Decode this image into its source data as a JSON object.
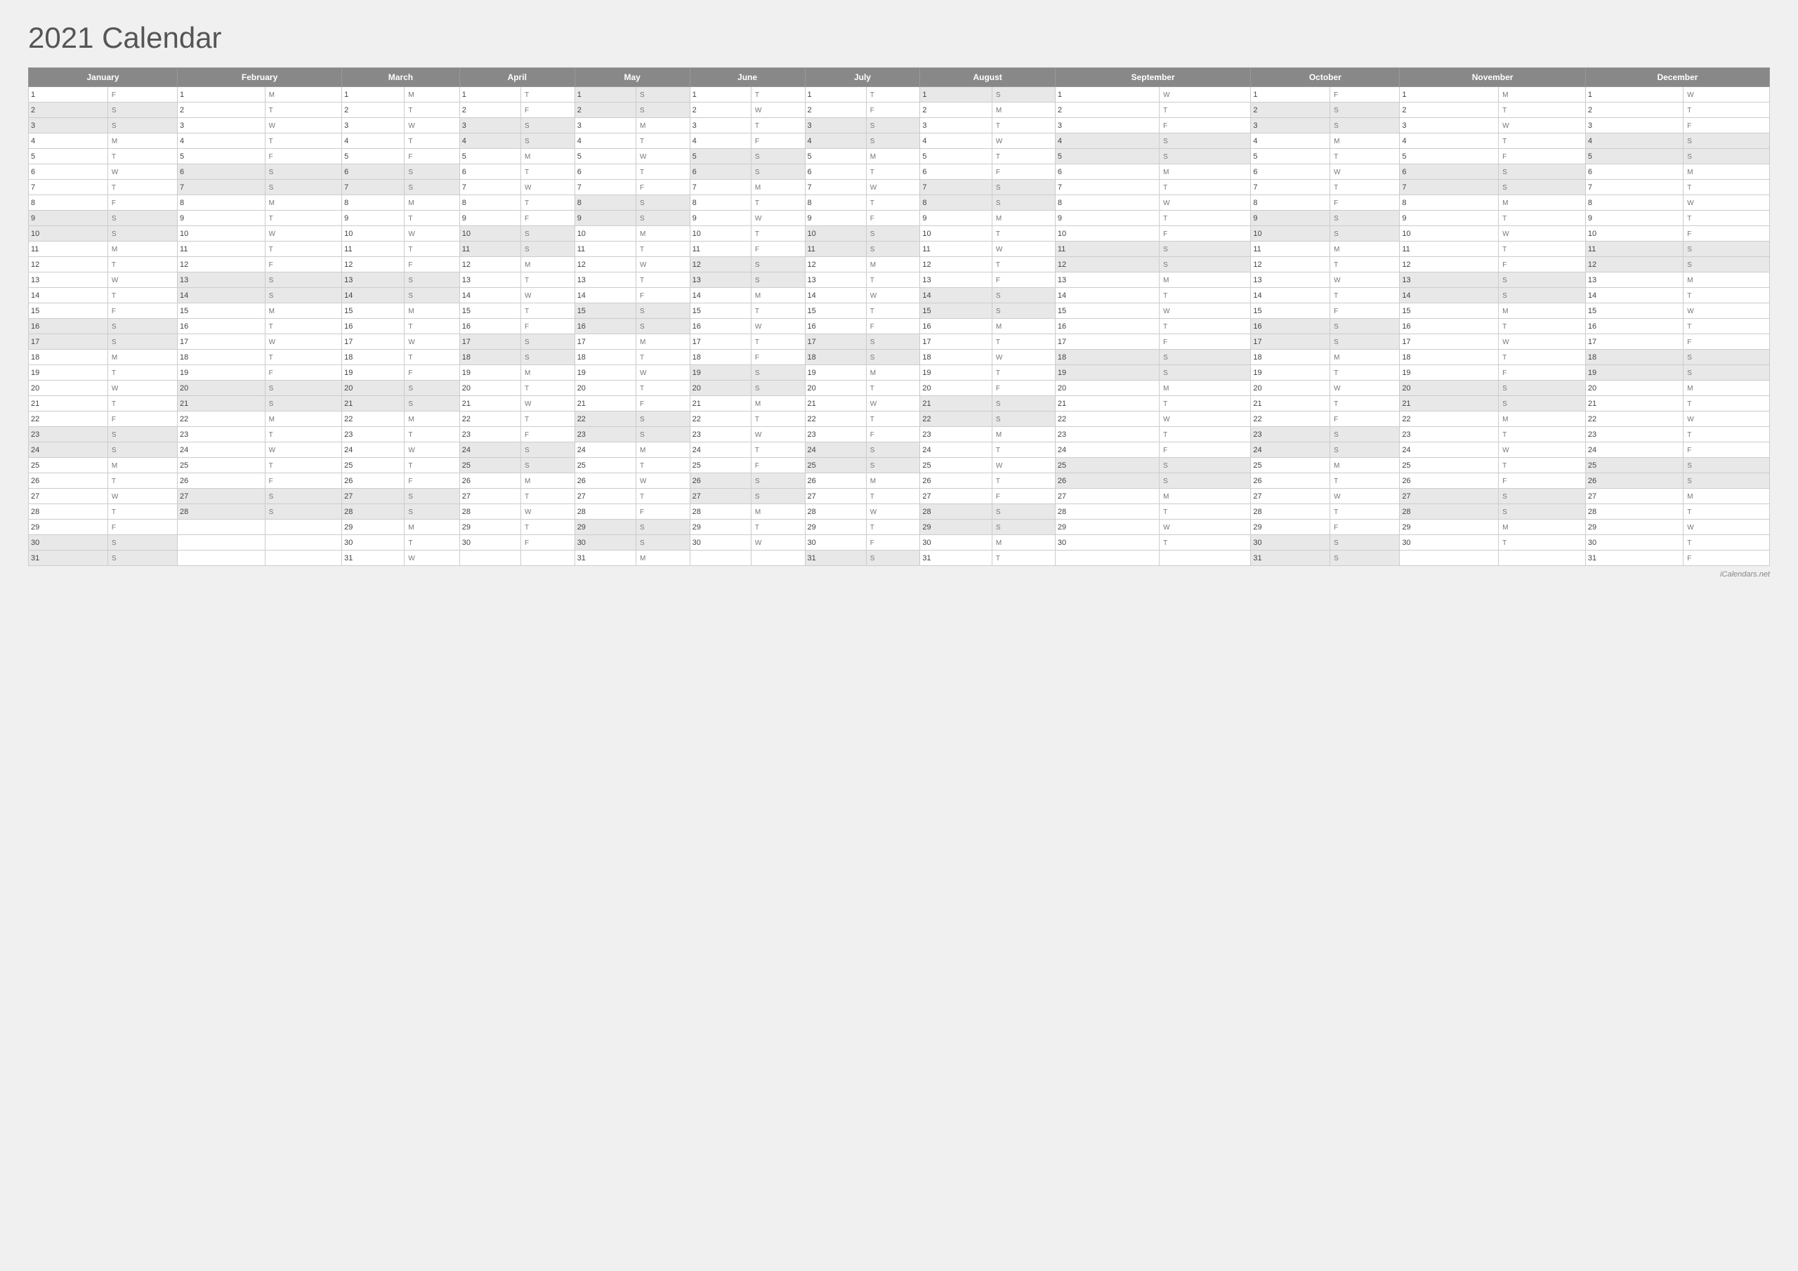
{
  "title": "2021 Calendar",
  "footer": "iCalendars.net",
  "months": [
    "January",
    "February",
    "March",
    "April",
    "May",
    "June",
    "July",
    "August",
    "September",
    "October",
    "November",
    "December"
  ],
  "calendar": {
    "January": [
      [
        "1",
        "F"
      ],
      [
        "2",
        "S"
      ],
      [
        "3",
        "S"
      ],
      [
        "4",
        "M"
      ],
      [
        "5",
        "T"
      ],
      [
        "6",
        "W"
      ],
      [
        "7",
        "T"
      ],
      [
        "8",
        "F"
      ],
      [
        "9",
        "S"
      ],
      [
        "10",
        "S"
      ],
      [
        "11",
        "M"
      ],
      [
        "12",
        "T"
      ],
      [
        "13",
        "W"
      ],
      [
        "14",
        "T"
      ],
      [
        "15",
        "F"
      ],
      [
        "16",
        "S"
      ],
      [
        "17",
        "S"
      ],
      [
        "18",
        "M"
      ],
      [
        "19",
        "T"
      ],
      [
        "20",
        "W"
      ],
      [
        "21",
        "T"
      ],
      [
        "22",
        "F"
      ],
      [
        "23",
        "S"
      ],
      [
        "24",
        "S"
      ],
      [
        "25",
        "M"
      ],
      [
        "26",
        "T"
      ],
      [
        "27",
        "W"
      ],
      [
        "28",
        "T"
      ],
      [
        "29",
        "F"
      ],
      [
        "30",
        "S"
      ],
      [
        "31",
        "S"
      ]
    ],
    "February": [
      [
        "1",
        "M"
      ],
      [
        "2",
        "T"
      ],
      [
        "3",
        "W"
      ],
      [
        "4",
        "T"
      ],
      [
        "5",
        "F"
      ],
      [
        "6",
        "S"
      ],
      [
        "7",
        "S"
      ],
      [
        "8",
        "M"
      ],
      [
        "9",
        "T"
      ],
      [
        "10",
        "W"
      ],
      [
        "11",
        "T"
      ],
      [
        "12",
        "F"
      ],
      [
        "13",
        "S"
      ],
      [
        "14",
        "S"
      ],
      [
        "15",
        "M"
      ],
      [
        "16",
        "T"
      ],
      [
        "17",
        "W"
      ],
      [
        "18",
        "T"
      ],
      [
        "19",
        "F"
      ],
      [
        "20",
        "S"
      ],
      [
        "21",
        "S"
      ],
      [
        "22",
        "M"
      ],
      [
        "23",
        "T"
      ],
      [
        "24",
        "W"
      ],
      [
        "25",
        "T"
      ],
      [
        "26",
        "F"
      ],
      [
        "27",
        "S"
      ],
      [
        "28",
        "S"
      ],
      null,
      null,
      null
    ],
    "March": [
      [
        "1",
        "M"
      ],
      [
        "2",
        "T"
      ],
      [
        "3",
        "W"
      ],
      [
        "4",
        "T"
      ],
      [
        "5",
        "F"
      ],
      [
        "6",
        "S"
      ],
      [
        "7",
        "S"
      ],
      [
        "8",
        "M"
      ],
      [
        "9",
        "T"
      ],
      [
        "10",
        "W"
      ],
      [
        "11",
        "T"
      ],
      [
        "12",
        "F"
      ],
      [
        "13",
        "S"
      ],
      [
        "14",
        "S"
      ],
      [
        "15",
        "M"
      ],
      [
        "16",
        "T"
      ],
      [
        "17",
        "W"
      ],
      [
        "18",
        "T"
      ],
      [
        "19",
        "F"
      ],
      [
        "20",
        "S"
      ],
      [
        "21",
        "S"
      ],
      [
        "22",
        "M"
      ],
      [
        "23",
        "T"
      ],
      [
        "24",
        "W"
      ],
      [
        "25",
        "T"
      ],
      [
        "26",
        "F"
      ],
      [
        "27",
        "S"
      ],
      [
        "28",
        "S"
      ],
      [
        "29",
        "M"
      ],
      [
        "30",
        "T"
      ],
      [
        "31",
        "W"
      ]
    ],
    "April": [
      [
        "1",
        "T"
      ],
      [
        "2",
        "F"
      ],
      [
        "3",
        "S"
      ],
      [
        "4",
        "S"
      ],
      [
        "5",
        "M"
      ],
      [
        "6",
        "T"
      ],
      [
        "7",
        "W"
      ],
      [
        "8",
        "T"
      ],
      [
        "9",
        "F"
      ],
      [
        "10",
        "S"
      ],
      [
        "11",
        "S"
      ],
      [
        "12",
        "M"
      ],
      [
        "13",
        "T"
      ],
      [
        "14",
        "W"
      ],
      [
        "15",
        "T"
      ],
      [
        "16",
        "F"
      ],
      [
        "17",
        "S"
      ],
      [
        "18",
        "S"
      ],
      [
        "19",
        "M"
      ],
      [
        "20",
        "T"
      ],
      [
        "21",
        "W"
      ],
      [
        "22",
        "T"
      ],
      [
        "23",
        "F"
      ],
      [
        "24",
        "S"
      ],
      [
        "25",
        "S"
      ],
      [
        "26",
        "M"
      ],
      [
        "27",
        "T"
      ],
      [
        "28",
        "W"
      ],
      [
        "29",
        "T"
      ],
      [
        "30",
        "F"
      ],
      null
    ],
    "May": [
      [
        "1",
        "S"
      ],
      [
        "2",
        "S"
      ],
      [
        "3",
        "M"
      ],
      [
        "4",
        "T"
      ],
      [
        "5",
        "W"
      ],
      [
        "6",
        "T"
      ],
      [
        "7",
        "F"
      ],
      [
        "8",
        "S"
      ],
      [
        "9",
        "S"
      ],
      [
        "10",
        "M"
      ],
      [
        "11",
        "T"
      ],
      [
        "12",
        "W"
      ],
      [
        "13",
        "T"
      ],
      [
        "14",
        "F"
      ],
      [
        "15",
        "S"
      ],
      [
        "16",
        "S"
      ],
      [
        "17",
        "M"
      ],
      [
        "18",
        "T"
      ],
      [
        "19",
        "W"
      ],
      [
        "20",
        "T"
      ],
      [
        "21",
        "F"
      ],
      [
        "22",
        "S"
      ],
      [
        "23",
        "S"
      ],
      [
        "24",
        "M"
      ],
      [
        "25",
        "T"
      ],
      [
        "26",
        "W"
      ],
      [
        "27",
        "T"
      ],
      [
        "28",
        "F"
      ],
      [
        "29",
        "S"
      ],
      [
        "30",
        "S"
      ],
      [
        "31",
        "M"
      ]
    ],
    "June": [
      [
        "1",
        "T"
      ],
      [
        "2",
        "W"
      ],
      [
        "3",
        "T"
      ],
      [
        "4",
        "F"
      ],
      [
        "5",
        "S"
      ],
      [
        "6",
        "S"
      ],
      [
        "7",
        "M"
      ],
      [
        "8",
        "T"
      ],
      [
        "9",
        "W"
      ],
      [
        "10",
        "T"
      ],
      [
        "11",
        "F"
      ],
      [
        "12",
        "S"
      ],
      [
        "13",
        "S"
      ],
      [
        "14",
        "M"
      ],
      [
        "15",
        "T"
      ],
      [
        "16",
        "W"
      ],
      [
        "17",
        "T"
      ],
      [
        "18",
        "F"
      ],
      [
        "19",
        "S"
      ],
      [
        "20",
        "S"
      ],
      [
        "21",
        "M"
      ],
      [
        "22",
        "T"
      ],
      [
        "23",
        "W"
      ],
      [
        "24",
        "T"
      ],
      [
        "25",
        "F"
      ],
      [
        "26",
        "S"
      ],
      [
        "27",
        "S"
      ],
      [
        "28",
        "M"
      ],
      [
        "29",
        "T"
      ],
      [
        "30",
        "W"
      ],
      null
    ],
    "July": [
      [
        "1",
        "T"
      ],
      [
        "2",
        "F"
      ],
      [
        "3",
        "S"
      ],
      [
        "4",
        "S"
      ],
      [
        "5",
        "M"
      ],
      [
        "6",
        "T"
      ],
      [
        "7",
        "W"
      ],
      [
        "8",
        "T"
      ],
      [
        "9",
        "F"
      ],
      [
        "10",
        "S"
      ],
      [
        "11",
        "S"
      ],
      [
        "12",
        "M"
      ],
      [
        "13",
        "T"
      ],
      [
        "14",
        "W"
      ],
      [
        "15",
        "T"
      ],
      [
        "16",
        "F"
      ],
      [
        "17",
        "S"
      ],
      [
        "18",
        "S"
      ],
      [
        "19",
        "M"
      ],
      [
        "20",
        "T"
      ],
      [
        "21",
        "W"
      ],
      [
        "22",
        "T"
      ],
      [
        "23",
        "F"
      ],
      [
        "24",
        "S"
      ],
      [
        "25",
        "S"
      ],
      [
        "26",
        "M"
      ],
      [
        "27",
        "T"
      ],
      [
        "28",
        "W"
      ],
      [
        "29",
        "T"
      ],
      [
        "30",
        "F"
      ],
      [
        "31",
        "S"
      ]
    ],
    "August": [
      [
        "1",
        "S"
      ],
      [
        "2",
        "M"
      ],
      [
        "3",
        "T"
      ],
      [
        "4",
        "W"
      ],
      [
        "5",
        "T"
      ],
      [
        "6",
        "F"
      ],
      [
        "7",
        "S"
      ],
      [
        "8",
        "S"
      ],
      [
        "9",
        "M"
      ],
      [
        "10",
        "T"
      ],
      [
        "11",
        "W"
      ],
      [
        "12",
        "T"
      ],
      [
        "13",
        "F"
      ],
      [
        "14",
        "S"
      ],
      [
        "15",
        "S"
      ],
      [
        "16",
        "M"
      ],
      [
        "17",
        "T"
      ],
      [
        "18",
        "W"
      ],
      [
        "19",
        "T"
      ],
      [
        "20",
        "F"
      ],
      [
        "21",
        "S"
      ],
      [
        "22",
        "S"
      ],
      [
        "23",
        "M"
      ],
      [
        "24",
        "T"
      ],
      [
        "25",
        "W"
      ],
      [
        "26",
        "T"
      ],
      [
        "27",
        "F"
      ],
      [
        "28",
        "S"
      ],
      [
        "29",
        "S"
      ],
      [
        "30",
        "M"
      ],
      [
        "31",
        "T"
      ]
    ],
    "September": [
      [
        "1",
        "W"
      ],
      [
        "2",
        "T"
      ],
      [
        "3",
        "F"
      ],
      [
        "4",
        "S"
      ],
      [
        "5",
        "S"
      ],
      [
        "6",
        "M"
      ],
      [
        "7",
        "T"
      ],
      [
        "8",
        "W"
      ],
      [
        "9",
        "T"
      ],
      [
        "10",
        "F"
      ],
      [
        "11",
        "S"
      ],
      [
        "12",
        "S"
      ],
      [
        "13",
        "M"
      ],
      [
        "14",
        "T"
      ],
      [
        "15",
        "W"
      ],
      [
        "16",
        "T"
      ],
      [
        "17",
        "F"
      ],
      [
        "18",
        "S"
      ],
      [
        "19",
        "S"
      ],
      [
        "20",
        "M"
      ],
      [
        "21",
        "T"
      ],
      [
        "22",
        "W"
      ],
      [
        "23",
        "T"
      ],
      [
        "24",
        "F"
      ],
      [
        "25",
        "S"
      ],
      [
        "26",
        "S"
      ],
      [
        "27",
        "M"
      ],
      [
        "28",
        "T"
      ],
      [
        "29",
        "W"
      ],
      [
        "30",
        "T"
      ],
      null
    ],
    "October": [
      [
        "1",
        "F"
      ],
      [
        "2",
        "S"
      ],
      [
        "3",
        "S"
      ],
      [
        "4",
        "M"
      ],
      [
        "5",
        "T"
      ],
      [
        "6",
        "W"
      ],
      [
        "7",
        "T"
      ],
      [
        "8",
        "F"
      ],
      [
        "9",
        "S"
      ],
      [
        "10",
        "S"
      ],
      [
        "11",
        "M"
      ],
      [
        "12",
        "T"
      ],
      [
        "13",
        "W"
      ],
      [
        "14",
        "T"
      ],
      [
        "15",
        "F"
      ],
      [
        "16",
        "S"
      ],
      [
        "17",
        "S"
      ],
      [
        "18",
        "M"
      ],
      [
        "19",
        "T"
      ],
      [
        "20",
        "W"
      ],
      [
        "21",
        "T"
      ],
      [
        "22",
        "F"
      ],
      [
        "23",
        "S"
      ],
      [
        "24",
        "S"
      ],
      [
        "25",
        "M"
      ],
      [
        "26",
        "T"
      ],
      [
        "27",
        "W"
      ],
      [
        "28",
        "T"
      ],
      [
        "29",
        "F"
      ],
      [
        "30",
        "S"
      ],
      [
        "31",
        "S"
      ]
    ],
    "November": [
      [
        "1",
        "M"
      ],
      [
        "2",
        "T"
      ],
      [
        "3",
        "W"
      ],
      [
        "4",
        "T"
      ],
      [
        "5",
        "F"
      ],
      [
        "6",
        "S"
      ],
      [
        "7",
        "S"
      ],
      [
        "8",
        "M"
      ],
      [
        "9",
        "T"
      ],
      [
        "10",
        "W"
      ],
      [
        "11",
        "T"
      ],
      [
        "12",
        "F"
      ],
      [
        "13",
        "S"
      ],
      [
        "14",
        "S"
      ],
      [
        "15",
        "M"
      ],
      [
        "16",
        "T"
      ],
      [
        "17",
        "W"
      ],
      [
        "18",
        "T"
      ],
      [
        "19",
        "F"
      ],
      [
        "20",
        "S"
      ],
      [
        "21",
        "S"
      ],
      [
        "22",
        "M"
      ],
      [
        "23",
        "T"
      ],
      [
        "24",
        "W"
      ],
      [
        "25",
        "T"
      ],
      [
        "26",
        "F"
      ],
      [
        "27",
        "S"
      ],
      [
        "28",
        "S"
      ],
      [
        "29",
        "M"
      ],
      [
        "30",
        "T"
      ],
      null
    ],
    "December": [
      [
        "1",
        "W"
      ],
      [
        "2",
        "T"
      ],
      [
        "3",
        "F"
      ],
      [
        "4",
        "S"
      ],
      [
        "5",
        "S"
      ],
      [
        "6",
        "M"
      ],
      [
        "7",
        "T"
      ],
      [
        "8",
        "W"
      ],
      [
        "9",
        "T"
      ],
      [
        "10",
        "F"
      ],
      [
        "11",
        "S"
      ],
      [
        "12",
        "S"
      ],
      [
        "13",
        "M"
      ],
      [
        "14",
        "T"
      ],
      [
        "15",
        "W"
      ],
      [
        "16",
        "T"
      ],
      [
        "17",
        "F"
      ],
      [
        "18",
        "S"
      ],
      [
        "19",
        "S"
      ],
      [
        "20",
        "M"
      ],
      [
        "21",
        "T"
      ],
      [
        "22",
        "W"
      ],
      [
        "23",
        "T"
      ],
      [
        "24",
        "F"
      ],
      [
        "25",
        "S"
      ],
      [
        "26",
        "S"
      ],
      [
        "27",
        "M"
      ],
      [
        "28",
        "T"
      ],
      [
        "29",
        "W"
      ],
      [
        "30",
        "T"
      ],
      [
        "31",
        "F"
      ]
    ]
  }
}
